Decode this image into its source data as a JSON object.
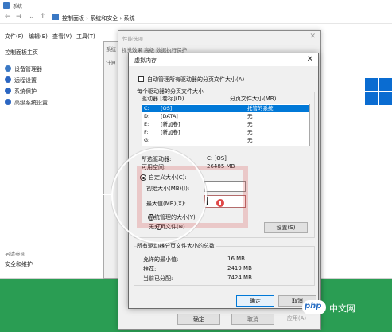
{
  "system_window": {
    "title": "系统",
    "breadcrumbs": [
      "控制面板",
      "系统和安全",
      "系统"
    ],
    "menu": [
      "文件(F)",
      "编辑(E)",
      "查看(V)",
      "工具(T)"
    ],
    "sidebar": {
      "header": "控制面板主页",
      "items": [
        {
          "label": "设备管理器",
          "icon": "device-manager-icon"
        },
        {
          "label": "远程设置",
          "icon": "shield-icon"
        },
        {
          "label": "系统保护",
          "icon": "shield-icon"
        },
        {
          "label": "高级系统设置",
          "icon": "shield-icon"
        }
      ],
      "see_also": "另请参阅",
      "see_also_items": [
        "安全和维护"
      ]
    },
    "accent": "#0a6cd1"
  },
  "system_properties": {
    "tab_fragment": "系统",
    "tab_fragment2": "计算"
  },
  "performance_options": {
    "title": "性能选项",
    "tabs": "视觉效果  高级  数据执行保护",
    "ok": "确定",
    "cancel": "取消",
    "apply": "应用(A)"
  },
  "virtual_memory": {
    "title": "虚拟内存",
    "auto_manage_label": "自动管理所有驱动器的分页文件大小(A)",
    "auto_manage_checked": false,
    "group_title": "每个驱动器的分页文件大小",
    "col_drive": "驱动器 [卷标](D)",
    "col_size": "分页文件大小(MB)",
    "drives": [
      {
        "letter": "C:",
        "label": "[OS]",
        "size": "托管的系统",
        "selected": true
      },
      {
        "letter": "D:",
        "label": "[DATA]",
        "size": "无",
        "selected": false
      },
      {
        "letter": "E:",
        "label": "[新加卷]",
        "size": "无",
        "selected": false
      },
      {
        "letter": "F:",
        "label": "[新加卷]",
        "size": "无",
        "selected": false
      },
      {
        "letter": "G:",
        "label": "",
        "size": "无",
        "selected": false
      }
    ],
    "selected_drive_label": "所选驱动器:",
    "selected_drive_value": "C: [OS]",
    "free_space_label": "可用空间:",
    "free_space_value": "26485 MB",
    "custom_size_label": "自定义大小(C):",
    "initial_size_label": "初始大小(MB)(I):",
    "initial_size_value": "",
    "max_size_label": "最大值(MB)(X):",
    "max_size_value": "",
    "system_managed_label": "系统管理的大小(Y)",
    "no_paging_label": "无分页文件(N)",
    "set_button": "设置(S)",
    "total_title": "所有驱动器分页文件大小的总数",
    "min_allowed_label": "允许的最小值:",
    "min_allowed_value": "16 MB",
    "recommended_label": "推荐:",
    "recommended_value": "2419 MB",
    "currently_allocated_label": "当前已分配:",
    "currently_allocated_value": "7424 MB",
    "ok": "确定",
    "cancel": "取消"
  },
  "watermark": {
    "badge": "php",
    "text": "中文网"
  }
}
